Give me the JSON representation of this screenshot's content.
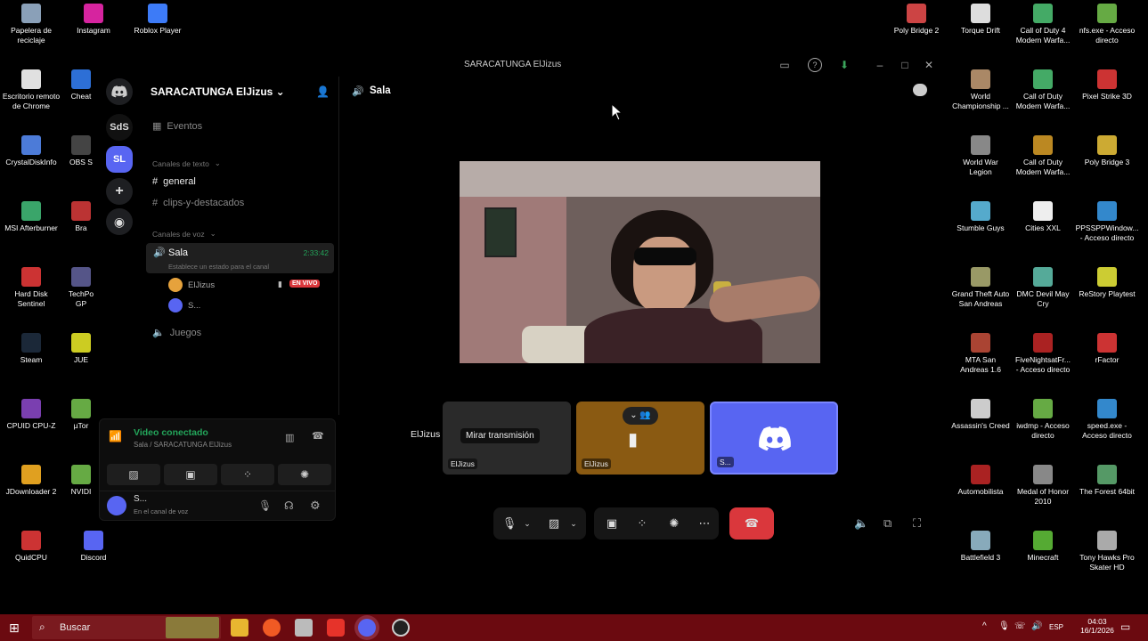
{
  "desktop_left": [
    {
      "id": "recycle",
      "label": "Papelera de\nreciclaje",
      "color": "#8aa0b8"
    },
    {
      "id": "instagram",
      "label": "Instagram",
      "color": "#d6249f"
    },
    {
      "id": "roblox",
      "label": "Roblox Player",
      "color": "#3d7bf7"
    },
    {
      "id": "remote",
      "label": "Escritorio remoto\nde Chrome",
      "color": "#e0e0e0"
    },
    {
      "id": "cheat",
      "label": "Cheat",
      "color": "#2d6fd6"
    },
    {
      "id": "crystal",
      "label": "CrystalDiskInfo",
      "color": "#4c7bd8"
    },
    {
      "id": "obs",
      "label": "OBS S",
      "color": "#444"
    },
    {
      "id": "msi",
      "label": "MSI Afterburner",
      "color": "#3aa56a"
    },
    {
      "id": "bra",
      "label": "Bra",
      "color": "#b33"
    },
    {
      "id": "hds",
      "label": "Hard Disk\nSentinel",
      "color": "#c33"
    },
    {
      "id": "techpo",
      "label": "TechPo\nGP",
      "color": "#558"
    },
    {
      "id": "steam",
      "label": "Steam",
      "color": "#1b2838"
    },
    {
      "id": "jue",
      "label": "JUE",
      "color": "#cc2"
    },
    {
      "id": "cpuid",
      "label": "CPUID CPU-Z",
      "color": "#7a3fb0"
    },
    {
      "id": "utor",
      "label": "µTor",
      "color": "#6a4"
    },
    {
      "id": "jdown",
      "label": "JDownloader 2",
      "color": "#e0a020"
    },
    {
      "id": "nvid",
      "label": "NVIDI",
      "color": "#6a4"
    },
    {
      "id": "quidcpu",
      "label": "QuidCPU",
      "color": "#c33"
    },
    {
      "id": "discord",
      "label": "Discord",
      "color": "#5865f2"
    }
  ],
  "desktop_right": [
    {
      "id": "pb2",
      "label": "Poly Bridge 2",
      "color": "#c44"
    },
    {
      "id": "torque",
      "label": "Torque Drift",
      "color": "#ddd"
    },
    {
      "id": "cod4",
      "label": "Call of Duty 4\nModern Warfa...",
      "color": "#4a6"
    },
    {
      "id": "nfs",
      "label": "nfs.exe - Acceso\ndirecto",
      "color": "#6a4"
    },
    {
      "id": "wcr",
      "label": "World\nChampionship ...",
      "color": "#a86"
    },
    {
      "id": "codmw",
      "label": "Call of Duty\nModern Warfa...",
      "color": "#4a6"
    },
    {
      "id": "pixel",
      "label": "Pixel Strike 3D",
      "color": "#c33"
    },
    {
      "id": "wwl",
      "label": "World War\nLegion",
      "color": "#888"
    },
    {
      "id": "codmw2",
      "label": "Call of Duty\nModern Warfa...",
      "color": "#b82"
    },
    {
      "id": "pb3",
      "label": "Poly Bridge 3",
      "color": "#ca3"
    },
    {
      "id": "stumble",
      "label": "Stumble Guys",
      "color": "#5ac"
    },
    {
      "id": "cities",
      "label": "Cities XXL",
      "color": "#eee"
    },
    {
      "id": "ppsspp",
      "label": "PPSSPPWindow...\n- Acceso directo",
      "color": "#38c"
    },
    {
      "id": "gta",
      "label": "Grand Theft Auto\nSan Andreas",
      "color": "#996"
    },
    {
      "id": "dmc",
      "label": "DMC Devil May\nCry",
      "color": "#5a9"
    },
    {
      "id": "restory",
      "label": "ReStory Playtest",
      "color": "#cc3"
    },
    {
      "id": "mta",
      "label": "MTA San\nAndreas 1.6",
      "color": "#a43"
    },
    {
      "id": "fnaf",
      "label": "FiveNightsatFr...\n- Acceso directo",
      "color": "#a22"
    },
    {
      "id": "rfactor",
      "label": "rFactor",
      "color": "#c33"
    },
    {
      "id": "ac",
      "label": "Assassin's Creed",
      "color": "#ccc"
    },
    {
      "id": "iwdmp",
      "label": "iwdmp - Acceso\ndirecto",
      "color": "#6a4"
    },
    {
      "id": "speed",
      "label": "speed.exe -\nAcceso directo",
      "color": "#38c"
    },
    {
      "id": "automob",
      "label": "Automobilista",
      "color": "#a22"
    },
    {
      "id": "moh",
      "label": "Medal of Honor\n2010",
      "color": "#888"
    },
    {
      "id": "forest",
      "label": "The Forest 64bit",
      "color": "#596"
    },
    {
      "id": "bf3",
      "label": "Battlefield 3",
      "color": "#8ab"
    },
    {
      "id": "minecraft",
      "label": "Minecraft",
      "color": "#5a3"
    },
    {
      "id": "thps",
      "label": "Tony Hawks Pro\nSkater HD",
      "color": "#aaa"
    }
  ],
  "window": {
    "title": "SARACATUNGA ElJizus",
    "server_name": "SARACATUNGA ElJizus",
    "events_label": "Eventos",
    "text_category": "Canales de texto",
    "text_channels": [
      "general",
      "clips-y-destacados"
    ],
    "voice_category": "Canales de voz",
    "voice_channel": "Sala",
    "voice_timer": "2:33:42",
    "voice_status_hint": "Establece un estado para el canal",
    "members": [
      {
        "name": "ElJizus",
        "live_badge": "EN VIVO"
      },
      {
        "name": "S..."
      }
    ],
    "other_voice_channel": "Juegos",
    "guild_labels": [
      "SdS",
      "SL"
    ],
    "header_channel": "Sala"
  },
  "voice_panel": {
    "status": "Video conectado",
    "location": "Sala / SARACATUNGA ElJizus",
    "user_name": "S...",
    "user_status": "En el canal de voz"
  },
  "stage": {
    "main_user": "ElJizus",
    "tiles": [
      {
        "label": "ElJizus",
        "overlay_text": "Mirar transmisión"
      },
      {
        "label": "ElJizus"
      },
      {
        "label": "S..."
      }
    ]
  },
  "taskbar": {
    "search_placeholder": "Buscar",
    "lang": "ESP",
    "time": "04:03",
    "date": "16/1/2026"
  },
  "colors": {
    "discord_blurple": "#5865f2",
    "live_red": "#da373c",
    "connected_green": "#23a55a",
    "taskbar": "#6b0a10",
    "tile_brown": "#8a5a12"
  }
}
